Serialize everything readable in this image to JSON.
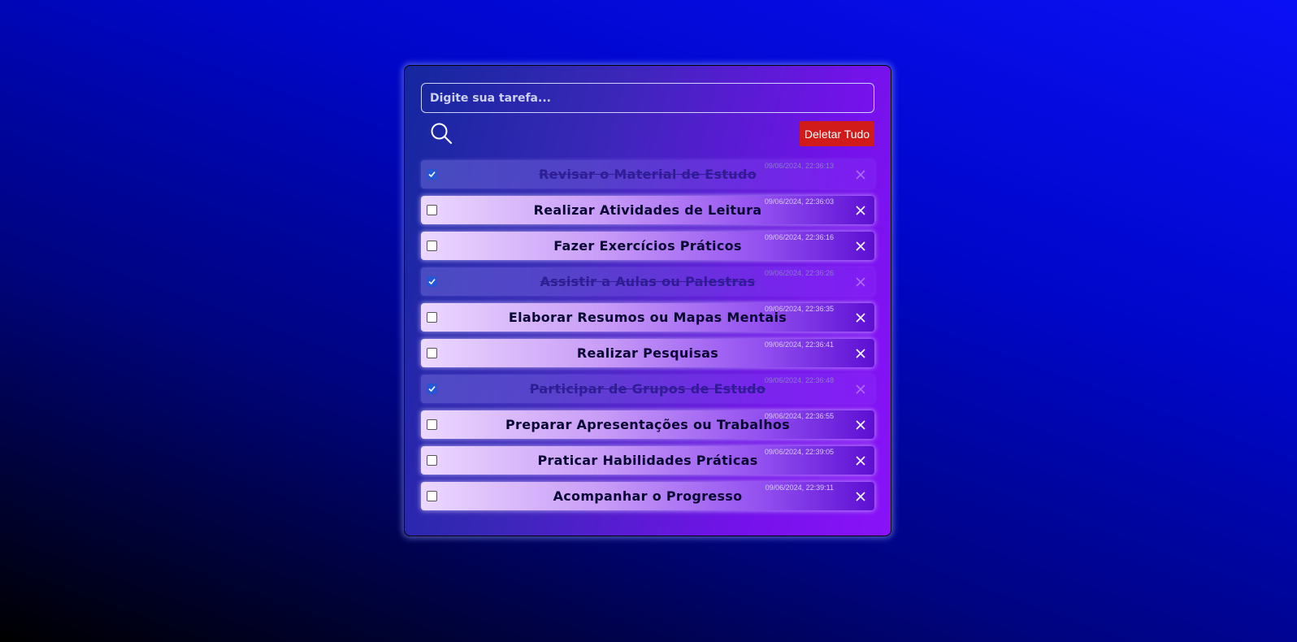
{
  "search": {
    "placeholder": "Digite sua tarefa..."
  },
  "toolbar": {
    "delete_all_label": "Deletar Tudo"
  },
  "tasks": [
    {
      "title": "Revisar o Material de Estudo",
      "date": "09/06/2024, 22:36:13",
      "done": true
    },
    {
      "title": "Realizar Atividades de Leitura",
      "date": "09/06/2024, 22:36:03",
      "done": false
    },
    {
      "title": "Fazer Exercícios Práticos",
      "date": "09/06/2024, 22:36:16",
      "done": false
    },
    {
      "title": "Assistir a Aulas ou Palestras",
      "date": "09/06/2024, 22:36:26",
      "done": true
    },
    {
      "title": "Elaborar Resumos ou Mapas Mentais",
      "date": "09/06/2024, 22:36:35",
      "done": false
    },
    {
      "title": "Realizar Pesquisas",
      "date": "09/06/2024, 22:36:41",
      "done": false
    },
    {
      "title": "Participar de Grupos de Estudo",
      "date": "09/06/2024, 22:36:48",
      "done": true
    },
    {
      "title": "Preparar Apresentações ou Trabalhos",
      "date": "09/06/2024, 22:36:55",
      "done": false
    },
    {
      "title": "Praticar Habilidades Práticas",
      "date": "09/06/2024, 22:39:05",
      "done": false
    },
    {
      "title": "Acompanhar o Progresso",
      "date": "09/06/2024, 22:39:11",
      "done": false
    }
  ]
}
